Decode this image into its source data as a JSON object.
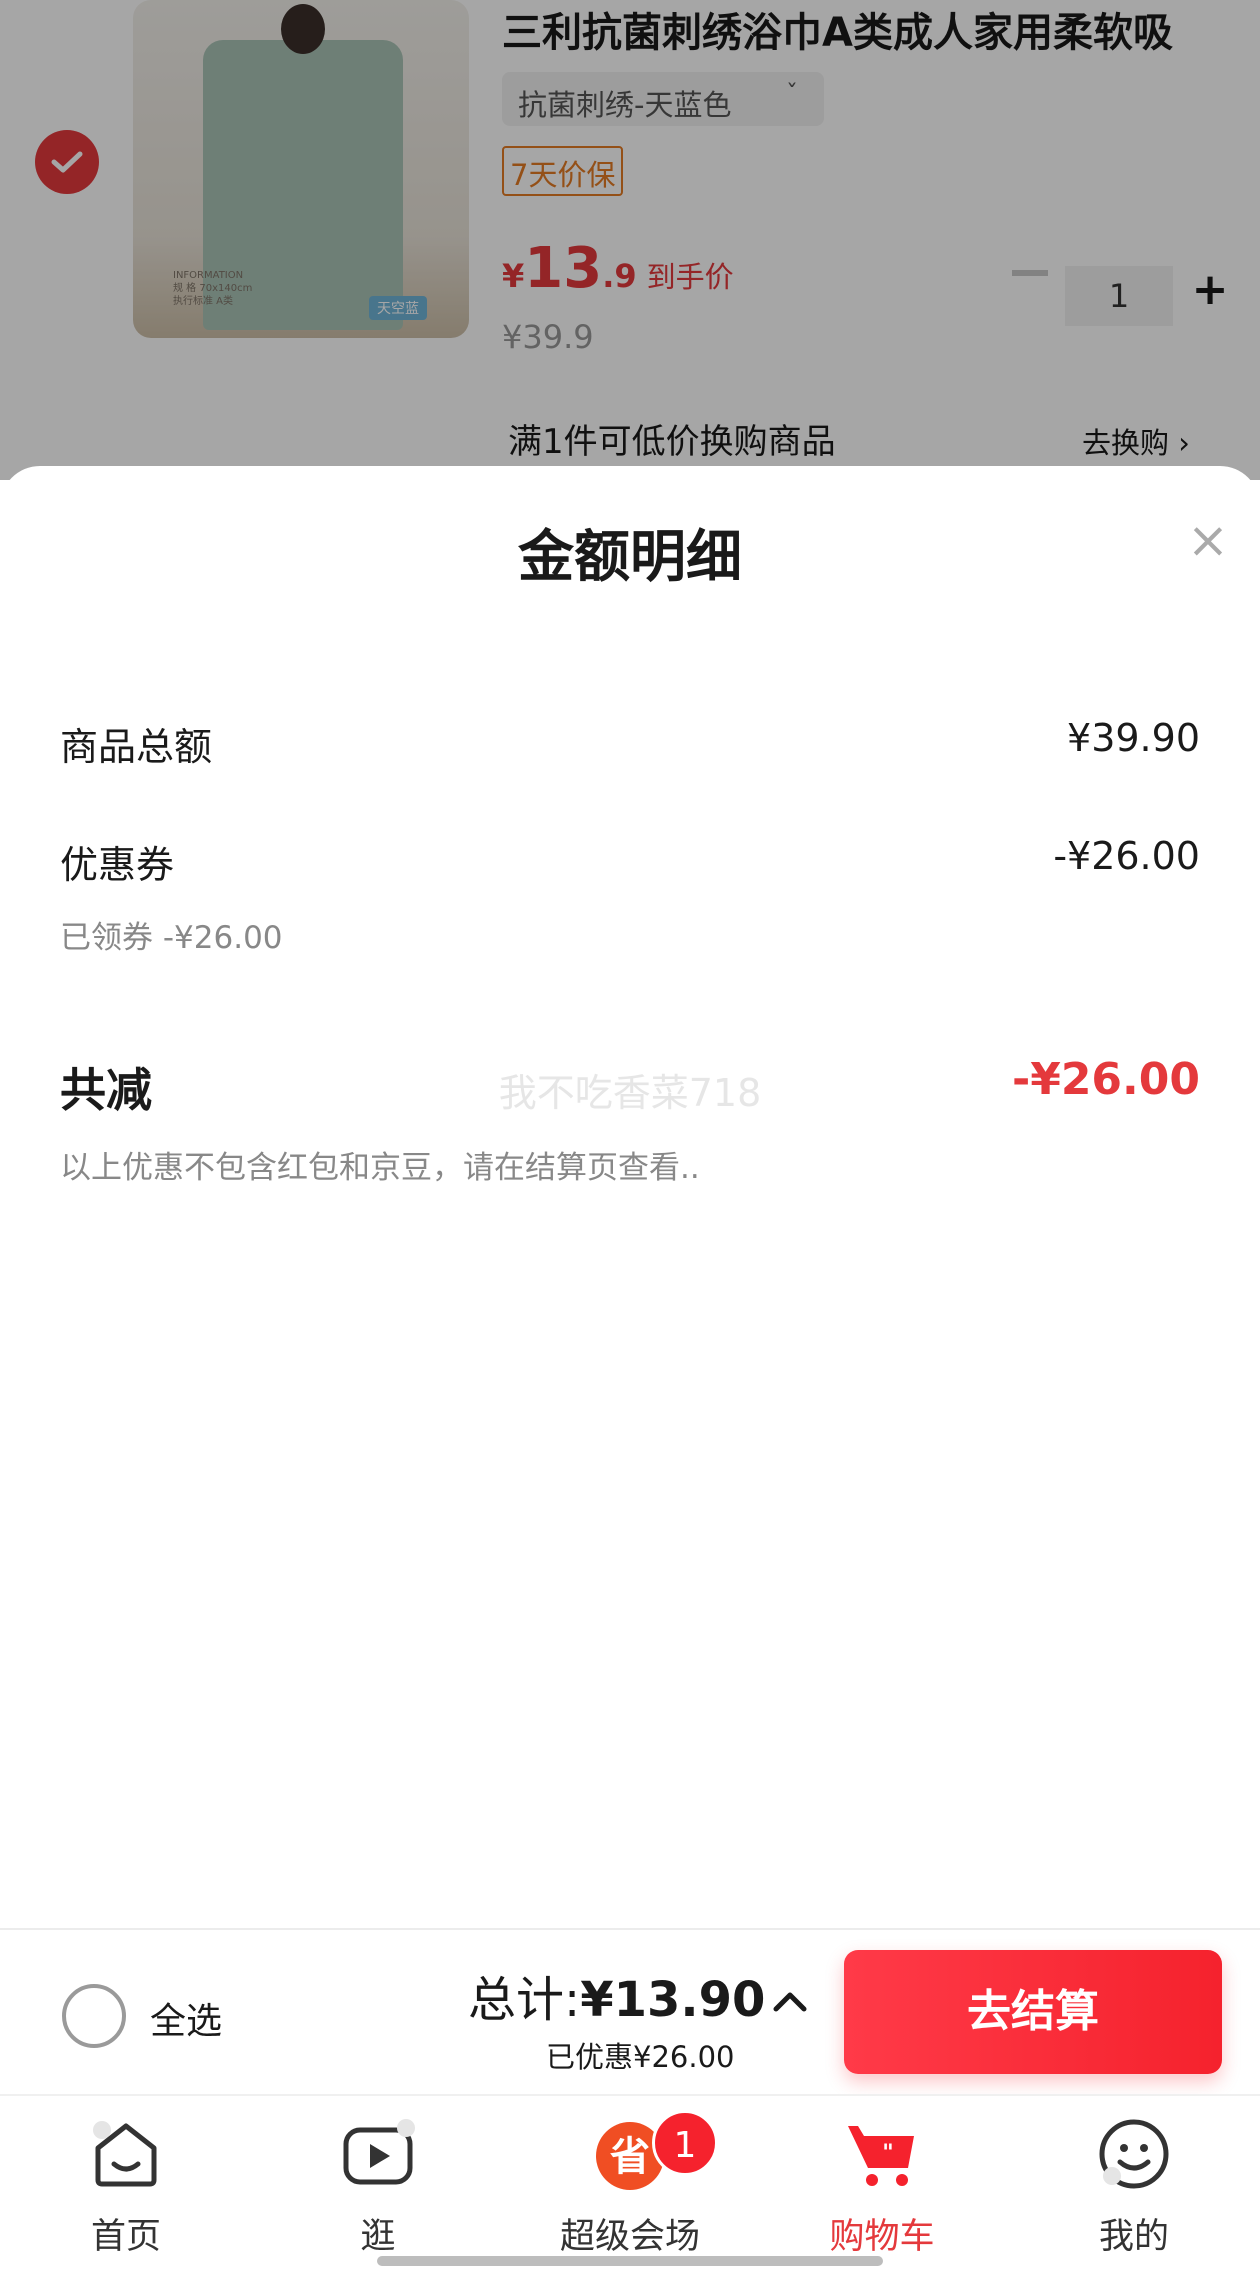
{
  "cart_item": {
    "title": "三利抗菌刺绣浴巾A类成人家用柔软吸",
    "spec": "抗菌刺绣-天蓝色",
    "guarantee_tag": "7天价保",
    "price_yen": "¥",
    "price_int": "13",
    "price_dec": ".9",
    "price_note": "到手价",
    "original_price": "¥39.9",
    "quantity": "1",
    "image_tag": "天空蓝",
    "image_info_1": "INFORMATION",
    "image_info_2": "规 格  70x140cm",
    "image_info_3": "执行标准  A类",
    "swap_text": "满1件可低价换购商品",
    "swap_link": "去换购 ›"
  },
  "sheet": {
    "title": "金额明细",
    "rows": [
      {
        "label": "商品总额",
        "value": "¥39.90"
      },
      {
        "label": "优惠券",
        "value": "-¥26.00",
        "note": "已领券 -¥26.00"
      }
    ],
    "total_label": "共减",
    "total_value": "-¥26.00",
    "watermark": "我不吃香菜718",
    "disclaimer": "以上优惠不包含红包和京豆，请在结算页查看.."
  },
  "checkout": {
    "select_all": "全选",
    "total_prefix": "总计:",
    "total_amount": "¥13.90",
    "saved": "已优惠¥26.00",
    "pay_button": "去结算"
  },
  "tabs": [
    {
      "label": "首页",
      "icon": "home-icon"
    },
    {
      "label": "逛",
      "icon": "play-icon"
    },
    {
      "label": "超级会场",
      "icon": "super-venue-icon",
      "badge": "1"
    },
    {
      "label": "购物车",
      "icon": "cart-icon",
      "active": true
    },
    {
      "label": "我的",
      "icon": "smile-icon"
    }
  ],
  "colors": {
    "accent": "#e4393c",
    "button": "#f5222d",
    "guarantee": "#e47b24"
  }
}
